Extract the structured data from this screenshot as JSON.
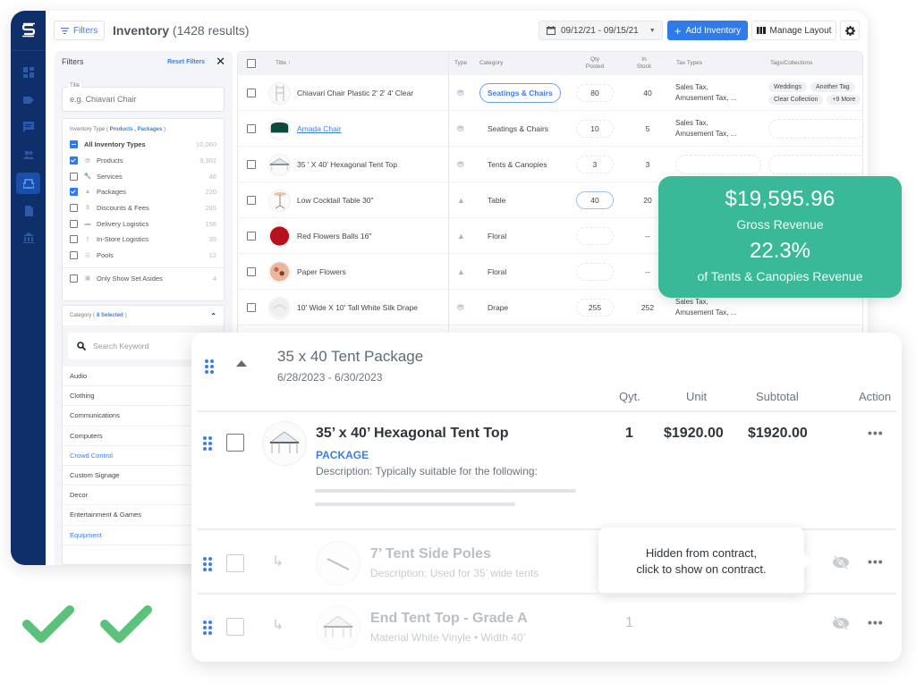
{
  "app": {
    "logo": "S",
    "rail_icons": [
      "dashboard-icon",
      "tag-icon",
      "chat-icon",
      "users-icon",
      "inventory-icon",
      "document-icon",
      "bank-icon"
    ],
    "active_rail": "inventory-icon"
  },
  "topbar": {
    "filters_label": "Filters",
    "title": "Inventory",
    "result_count": "(1428 results)",
    "date_range": "09/12/21 - 09/15/21",
    "add_label": "Add Inventory",
    "layout_label": "Manage Layout",
    "accent": "#2f7bea"
  },
  "filters": {
    "header": "Filters",
    "reset_label": "Reset Filters",
    "close_glyph": "✕",
    "title_label": "Title",
    "title_placeholder": "e.g. Chiavari Chair",
    "inventory_type": {
      "label": "Inventory Type (",
      "selected": "Products , Packages",
      "label_end": ")",
      "all": {
        "label": "All Inventory Types",
        "count": "10,060"
      },
      "items": [
        {
          "label": "Products",
          "count": "9,302",
          "checked": true,
          "icon": "chair-icon",
          "glyph": "⛃"
        },
        {
          "label": "Services",
          "count": "46",
          "checked": false,
          "icon": "wrench-icon",
          "glyph": "🔧"
        },
        {
          "label": "Packages",
          "count": "220",
          "checked": true,
          "icon": "package-icon",
          "glyph": "▲"
        },
        {
          "label": "Discounts & Fees",
          "count": "285",
          "checked": false,
          "icon": "discount-icon",
          "glyph": "$"
        },
        {
          "label": "Delivery Logistics",
          "count": "156",
          "checked": false,
          "icon": "truck-icon",
          "glyph": "▬"
        },
        {
          "label": "In-Store Logistics",
          "count": "35",
          "checked": false,
          "icon": "walker-icon",
          "glyph": "☨"
        },
        {
          "label": "Pools",
          "count": "12",
          "checked": false,
          "icon": "list-icon",
          "glyph": "☰"
        }
      ],
      "set_asides": {
        "label": "Only Show Set Asides",
        "count": "4"
      }
    },
    "category": {
      "label": "Category (",
      "selected": "8 Selected",
      "label_end": ")",
      "search_placeholder": "Search Keyword",
      "items": [
        {
          "label": "Audio",
          "selected": false
        },
        {
          "label": "Clothing",
          "selected": false
        },
        {
          "label": "Communications",
          "selected": false
        },
        {
          "label": "Computers",
          "selected": false
        },
        {
          "label": "Crowd Control",
          "selected": true
        },
        {
          "label": "Custom Signage",
          "selected": false
        },
        {
          "label": "Decor",
          "selected": false
        },
        {
          "label": "Entertainment & Games",
          "selected": false
        },
        {
          "label": "Equipment",
          "selected": true
        }
      ]
    }
  },
  "table": {
    "headers": {
      "title": "Title ↑",
      "type": "Type",
      "category": "Category",
      "qty_posted": "Qty Posted",
      "in_stock": "In Stock",
      "tax_types": "Tax Types",
      "tags": "Tags/Collections"
    },
    "rows": [
      {
        "title": "Chiavari Chair Plastic 2' 2' 4' Clear",
        "type": "product",
        "category": "Seatings & Chairs",
        "category_highlight": true,
        "qty": "80",
        "stock": "40",
        "tax": [
          "Sales Tax,",
          "Amusement Tax, ..."
        ],
        "tags": [
          "Weddings",
          "Another Tag",
          "Clear Collection",
          "+9 More"
        ],
        "link": false
      },
      {
        "title": "Amada Chair",
        "type": "product",
        "category": "Seatings & Chairs",
        "category_highlight": false,
        "qty": "10",
        "stock": "5",
        "tax": [
          "Sales Tax,",
          "Amusement Tax, ..."
        ],
        "tags": [],
        "link": true
      },
      {
        "title": "35 ' X 40' Hexagonal Tent Top",
        "type": "product",
        "category": "Tents & Canopies",
        "category_highlight": false,
        "qty": "3",
        "stock": "3",
        "tax": [],
        "tags": [],
        "link": false
      },
      {
        "title": "Low Cocktail Table 30\"",
        "type": "package",
        "category": "Table",
        "category_highlight": false,
        "qty": "40",
        "qty_active": true,
        "stock": "20",
        "tax": [],
        "tags": [],
        "link": false
      },
      {
        "title": "Red Flowers Balls 16\"",
        "type": "package",
        "category": "Floral",
        "category_highlight": false,
        "qty": "",
        "stock": "--",
        "tax": [],
        "tags": [],
        "link": false
      },
      {
        "title": "Paper Flowers",
        "type": "package",
        "category": "Floral",
        "category_highlight": false,
        "qty": "",
        "stock": "--",
        "tax": [],
        "tags": [],
        "link": false
      },
      {
        "title": "10' Wide X 10' Tall White Silk Drape",
        "type": "product",
        "category": "Drape",
        "category_highlight": false,
        "qty": "255",
        "stock": "252",
        "tax": [
          "Sales Tax,",
          "Amusement Tax, ..."
        ],
        "tags": [],
        "link": false
      }
    ]
  },
  "revenue": {
    "amount": "$19,595.96",
    "amount_label": "Gross Revenue",
    "percent": "22.3%",
    "percent_label": "of Tents & Canopies Revenue",
    "color": "#39b997"
  },
  "package": {
    "title": "35 x 40 Tent Package",
    "dates": "6/28/2023 - 6/30/2023",
    "columns": {
      "qty": "Qyt.",
      "unit": "Unit",
      "subtotal": "Subtotal",
      "action": "Action"
    },
    "main_item": {
      "title": "35’ x 40’ Hexagonal Tent Top",
      "badge": "PACKAGE",
      "description": "Description: Typically suitable for the following:",
      "qty": "1",
      "unit": "$1920.00",
      "subtotal": "$1920.00",
      "action": "•••"
    },
    "sub_items": [
      {
        "title": "7’ Tent Side Poles",
        "description": "Description: Used for 35’ wide tents",
        "qty": "",
        "hidden": true,
        "action": "•••"
      },
      {
        "title": "End Tent Top - Grade A",
        "description": "Material White Vinyle • Width 40’",
        "qty": "1",
        "hidden": true,
        "action": "•••"
      }
    ],
    "tooltip": [
      "Hidden from contract,",
      "click to show on contract."
    ]
  },
  "decor": {
    "check_color": "#5cc17a"
  }
}
